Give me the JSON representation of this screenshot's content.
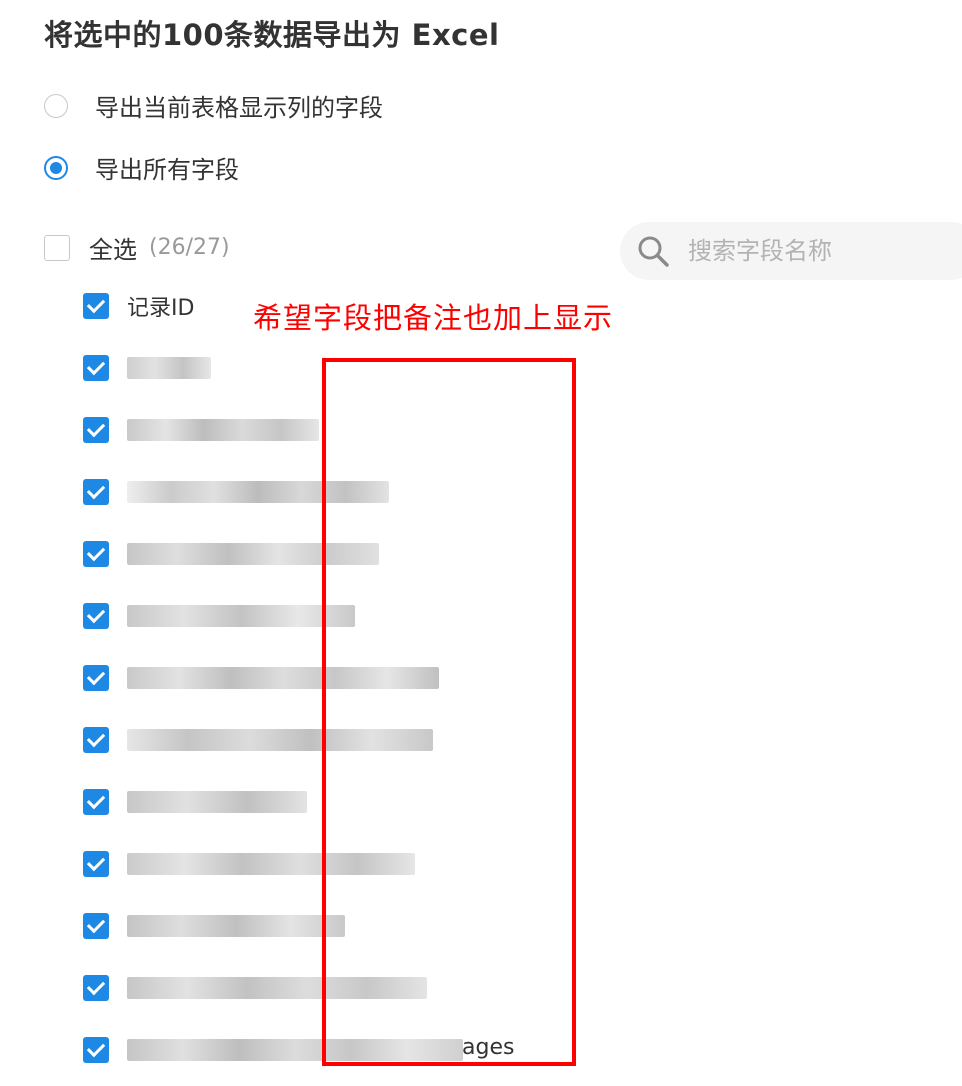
{
  "dialog": {
    "title": "将选中的100条数据导出为 Excel",
    "options": [
      {
        "label": "导出当前表格显示列的字段",
        "selected": false
      },
      {
        "label": "导出所有字段",
        "selected": true
      }
    ]
  },
  "fields": {
    "select_all_label": "全选",
    "count": "(26/27)",
    "search_placeholder": "搜索字段名称",
    "items": [
      {
        "label": "记录ID",
        "checked": true
      }
    ],
    "last_visible_suffix": "ages"
  },
  "annotation": {
    "text": "希望字段把备注也加上显示",
    "color": "#ff0000"
  },
  "colors": {
    "accent": "#1e88e5",
    "annotation": "#ff0000"
  }
}
